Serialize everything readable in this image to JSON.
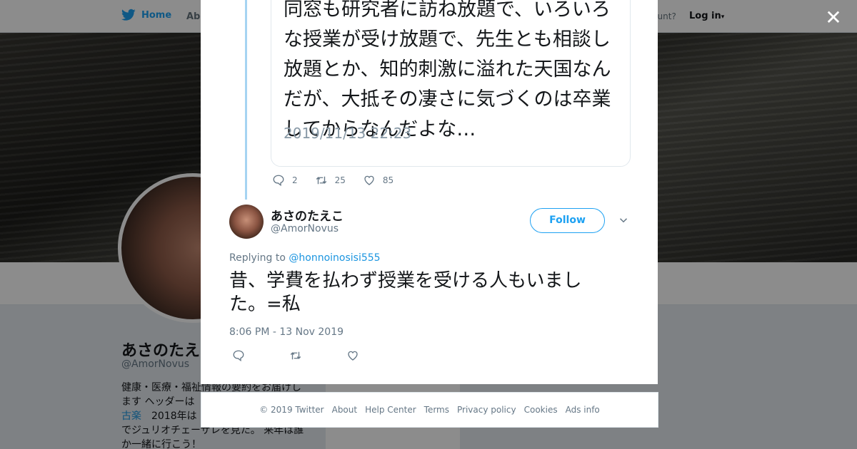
{
  "topbar": {
    "home_label": "Home",
    "about_label": "Abo",
    "account_label": "ccount?",
    "login_label": "Log in"
  },
  "profile": {
    "name": "あさのたえ",
    "handle": "@AmorNovus",
    "bio_line1": "健康・医療・福祉情報の要約をお届けし",
    "bio_line2": "ます ヘッダーは",
    "bio_link": "古楽",
    "bio_line3": "　2018年は",
    "bio_line4": "でジュリオチェーザレを見た。 来年は誰",
    "bio_line5": "か一緒に行こう！"
  },
  "quoted_tweet": {
    "text": "同窓も研究者に訪ね放題で、いろいろな授業が受け放題で、先生とも相談し放題とか、知的刺激に溢れた天国なんだが、大抵その凄さに気づくのは卒業してからなんだよな…",
    "date": "2019/11/13 22:23",
    "replies": "2",
    "retweets": "25",
    "likes": "85"
  },
  "reply_tweet": {
    "name": "あさのたえこ",
    "handle": "@AmorNovus",
    "follow_label": "Follow",
    "replying_prefix": "Replying to",
    "replying_to": "@honnoinosisi555",
    "text_line1": "昔、学費を払わず授業を受ける人もいまし",
    "text_line2": "た。=私",
    "timestamp": "8:06 PM - 13 Nov 2019"
  },
  "footer": {
    "copyright": "© 2019 Twitter",
    "links": [
      "About",
      "Help Center",
      "Terms",
      "Privacy policy",
      "Cookies",
      "Ads info"
    ]
  },
  "colors": {
    "brand": "#1da1f2",
    "thread_line": "#a6d4f2",
    "text_primary": "#14171a",
    "text_secondary": "#657786"
  }
}
